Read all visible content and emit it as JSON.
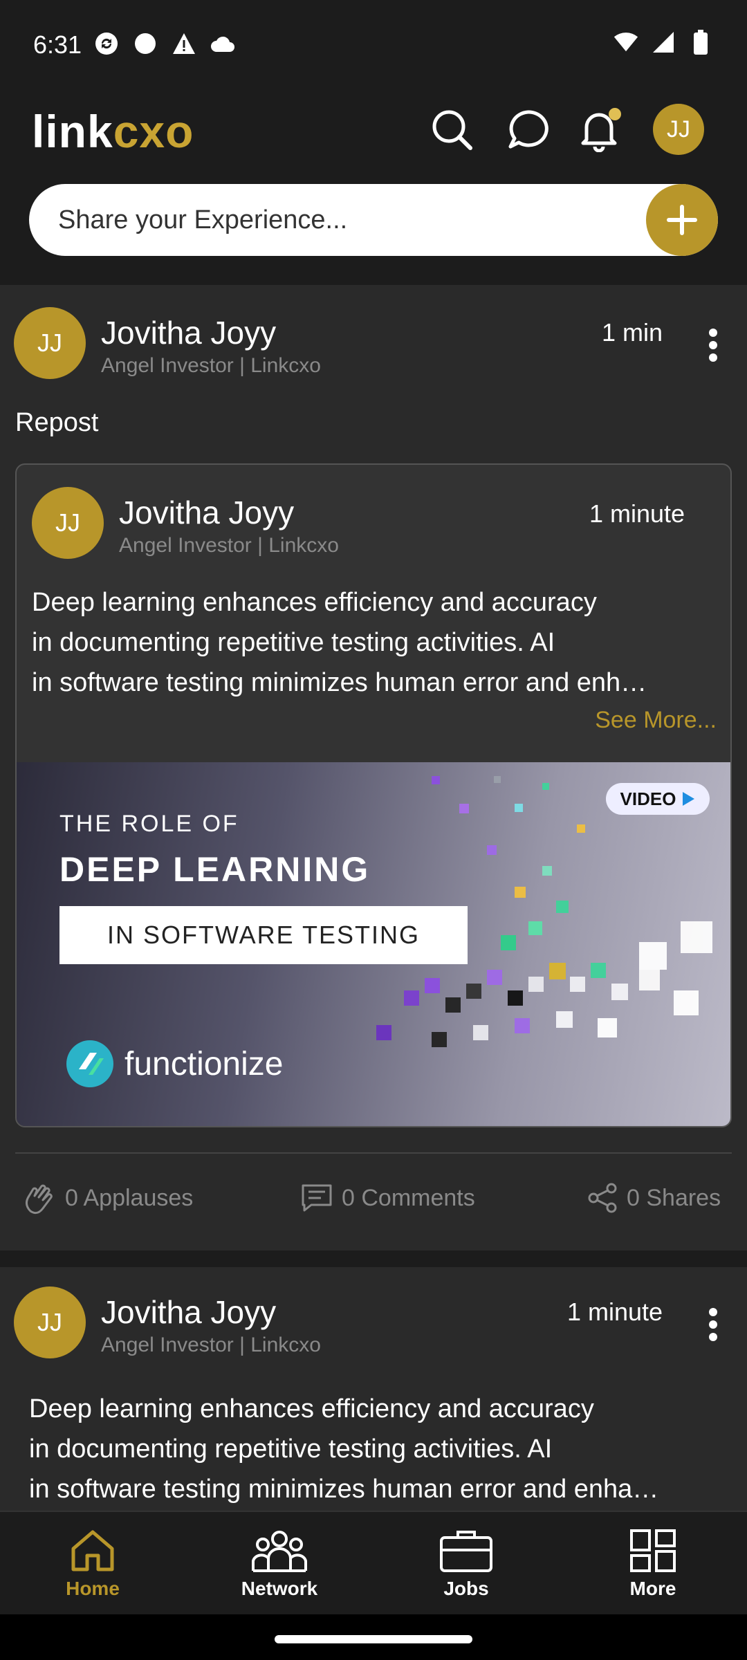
{
  "status_bar": {
    "time": "6:31"
  },
  "header": {
    "logo_a": "link",
    "logo_b": "cxo",
    "avatar_initials": "JJ",
    "share_placeholder": "Share your Experience..."
  },
  "colors": {
    "accent": "#b8962a",
    "background": "#1c1c1c",
    "card": "#2a2a2a"
  },
  "post1": {
    "initials": "JJ",
    "name": "Jovitha Joyy",
    "role": "Angel Investor | Linkcxo",
    "time": "1 min",
    "repost_label": "Repost",
    "inner": {
      "initials": "JJ",
      "name": "Jovitha Joyy",
      "role": "Angel Investor | Linkcxo",
      "time": "1 minute",
      "text_lines": [
        "Deep learning enhances efficiency and accuracy",
        "in documenting repetitive testing activities. AI",
        "in software testing minimizes human error and enh…"
      ],
      "see_more": "See More...",
      "media": {
        "subtitle": "THE ROLE OF",
        "title": "DEEP LEARNING",
        "boxed": "IN SOFTWARE TESTING",
        "brand": "functionize",
        "badge": "VIDEO"
      }
    },
    "actions": {
      "applauses": "0 Applauses",
      "comments": "0 Comments",
      "shares": "0 Shares"
    }
  },
  "post2": {
    "initials": "JJ",
    "name": "Jovitha Joyy",
    "role": "Angel Investor | Linkcxo",
    "time": "1 minute",
    "text_lines": [
      "Deep learning enhances efficiency and accuracy",
      "in documenting repetitive testing activities. AI",
      "in software testing minimizes human error and enha…"
    ]
  },
  "nav": {
    "home": "Home",
    "network": "Network",
    "jobs": "Jobs",
    "more": "More"
  }
}
